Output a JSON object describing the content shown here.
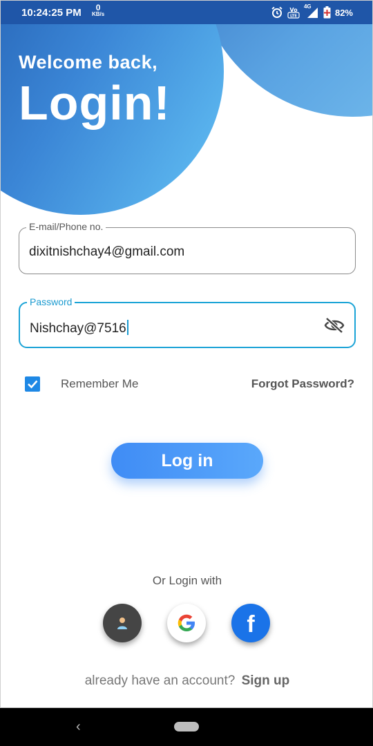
{
  "status_bar": {
    "time": "10:24:25 PM",
    "net_speed_value": "0",
    "net_speed_unit": "KB/s",
    "network": "4G",
    "battery": "82%",
    "icons": [
      "alarm-icon",
      "volte-icon",
      "signal-icon",
      "battery-icon"
    ]
  },
  "header": {
    "welcome": "Welcome back,",
    "title": "Login!"
  },
  "form": {
    "email": {
      "label": "E-mail/Phone no.",
      "value": "dixitnishchay4@gmail.com"
    },
    "password": {
      "label": "Password",
      "value": "Nishchay@7516",
      "toggle_icon": "eye-off-icon"
    },
    "remember_label": "Remember Me",
    "remember_checked": true,
    "forgot_label": "Forgot Password?",
    "login_button": "Log in"
  },
  "social": {
    "heading": "Or Login with",
    "providers": [
      "anonymous",
      "google",
      "facebook"
    ],
    "facebook_letter": "f"
  },
  "footer": {
    "prompt": "already have an account?",
    "link": "Sign up"
  },
  "nav_bar": {
    "back_glyph": "‹"
  },
  "colors": {
    "accent": "#1aa3d6",
    "button": "#4a9bf8",
    "header_blue": "#1f56a8",
    "facebook": "#1a73e8"
  }
}
